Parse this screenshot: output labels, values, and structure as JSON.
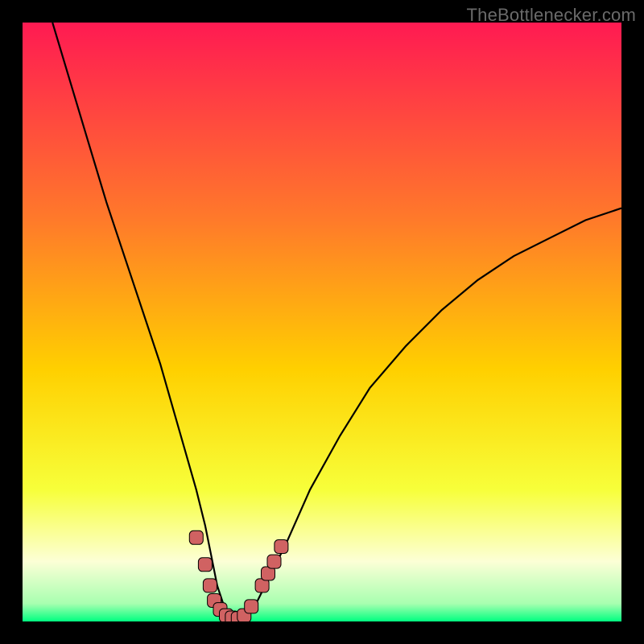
{
  "watermark": "TheBottlenecker.com",
  "colors": {
    "black": "#000000",
    "curve": "#000000",
    "marker_fill": "#d06262",
    "marker_stroke": "#000000",
    "gradient_top": "#ff1a52",
    "gradient_mid1": "#ff7a2a",
    "gradient_mid2": "#ffd000",
    "gradient_mid3": "#f7ff3a",
    "gradient_lemon": "#fcffd6",
    "gradient_green": "#00ff80"
  },
  "chart_data": {
    "type": "line",
    "title": "",
    "xlabel": "",
    "ylabel": "",
    "xlim": [
      0,
      100
    ],
    "ylim": [
      0,
      100
    ],
    "note": "Values estimated from pixels; axes have no tick labels.",
    "curve": {
      "x": [
        5,
        8,
        11,
        14,
        17,
        20,
        23,
        25,
        27,
        29,
        30.5,
        31.5,
        32.5,
        33.5,
        34.5,
        35.5,
        37,
        39,
        41,
        44,
        48,
        53,
        58,
        64,
        70,
        76,
        82,
        88,
        94,
        100
      ],
      "y": [
        100,
        90,
        80,
        70,
        61,
        52,
        43,
        36,
        29,
        22,
        16,
        11,
        6,
        3,
        1,
        0.5,
        1,
        3,
        7,
        13,
        22,
        31,
        39,
        46,
        52,
        57,
        61,
        64,
        67,
        69
      ]
    },
    "markers": [
      {
        "x": 29.0,
        "y": 14.0
      },
      {
        "x": 30.5,
        "y": 9.5
      },
      {
        "x": 31.3,
        "y": 6.0
      },
      {
        "x": 32.0,
        "y": 3.5
      },
      {
        "x": 33.0,
        "y": 2.0
      },
      {
        "x": 34.0,
        "y": 1.0
      },
      {
        "x": 35.0,
        "y": 0.6
      },
      {
        "x": 36.0,
        "y": 0.5
      },
      {
        "x": 37.0,
        "y": 1.0
      },
      {
        "x": 38.2,
        "y": 2.5
      },
      {
        "x": 40.0,
        "y": 6.0
      },
      {
        "x": 41.0,
        "y": 8.0
      },
      {
        "x": 42.0,
        "y": 10.0
      },
      {
        "x": 43.2,
        "y": 12.5
      }
    ]
  }
}
